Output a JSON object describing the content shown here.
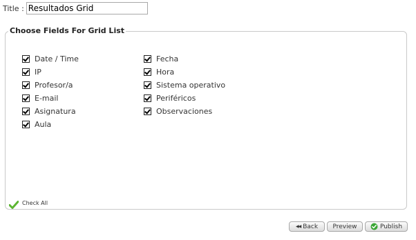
{
  "title_row": {
    "label": "Title :",
    "value": "Resultados Grid"
  },
  "fieldset": {
    "legend": "Choose Fields For Grid List",
    "left_fields": [
      {
        "label": "Date / Time",
        "checked": true
      },
      {
        "label": "IP",
        "checked": true
      },
      {
        "label": "Profesor/a",
        "checked": true
      },
      {
        "label": "E-mail",
        "checked": true
      },
      {
        "label": "Asignatura",
        "checked": true
      },
      {
        "label": "Aula",
        "checked": true
      }
    ],
    "right_fields": [
      {
        "label": "Fecha",
        "checked": true
      },
      {
        "label": "Hora",
        "checked": true
      },
      {
        "label": "Sistema operativo",
        "checked": true
      },
      {
        "label": "Periféricos",
        "checked": true
      },
      {
        "label": "Observaciones",
        "checked": true
      }
    ],
    "check_all_label": "Check All"
  },
  "buttons": {
    "back": "Back",
    "preview": "Preview",
    "publish": "Publish"
  },
  "colors": {
    "check_icon_green": "#5cb531",
    "publish_icon_green": "#3aa635"
  }
}
